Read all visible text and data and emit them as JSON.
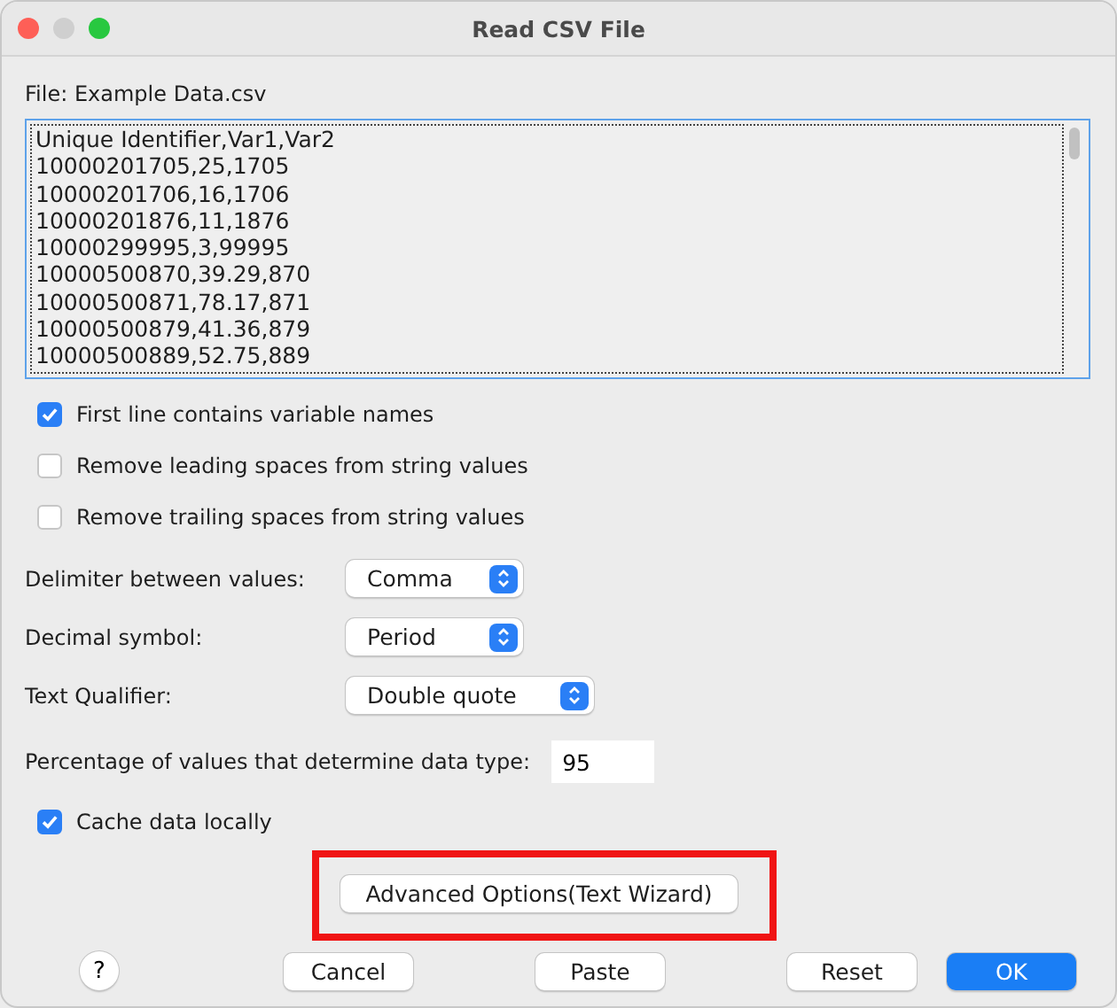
{
  "window": {
    "title": "Read CSV File"
  },
  "file_label": "File: Example Data.csv",
  "preview_lines": [
    "Unique Identifier,Var1,Var2",
    "10000201705,25,1705",
    "10000201706,16,1706",
    "10000201876,11,1876",
    "10000299995,3,99995",
    "10000500870,39.29,870",
    "10000500871,78.17,871",
    "10000500879,41.36,879",
    "10000500889,52.75,889"
  ],
  "options": [
    {
      "label": "First line contains variable names",
      "checked": true
    },
    {
      "label": "Remove leading spaces from string values",
      "checked": false
    },
    {
      "label": "Remove trailing spaces from string values",
      "checked": false
    }
  ],
  "selects": [
    {
      "label": "Delimiter between values:",
      "value": "Comma"
    },
    {
      "label": "Decimal symbol:",
      "value": "Period"
    },
    {
      "label": "Text Qualifier:",
      "value": "Double quote"
    }
  ],
  "percentage": {
    "label": "Percentage of values that determine data type:",
    "value": "95"
  },
  "cache": {
    "label": "Cache data locally",
    "checked": true
  },
  "advanced_button": {
    "label": "Advanced Options(Text Wizard)",
    "highlighted": true
  },
  "help_button": "?",
  "buttons": [
    {
      "label": "Cancel",
      "kind": "plain"
    },
    {
      "label": "Paste",
      "kind": "plain"
    },
    {
      "label": "Reset",
      "kind": "plain"
    },
    {
      "label": "OK",
      "kind": "default"
    }
  ]
}
